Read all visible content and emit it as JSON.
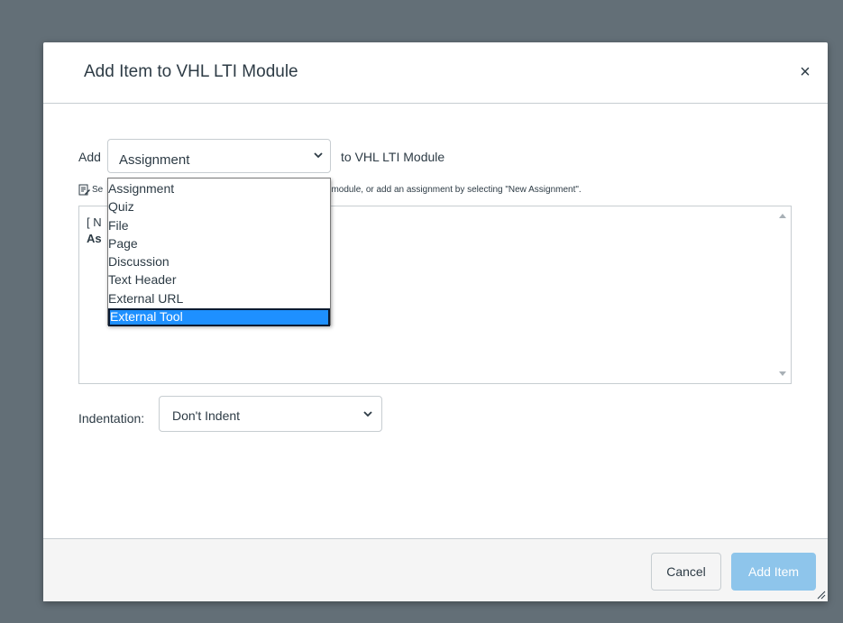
{
  "modal": {
    "title": "Add Item to VHL LTI Module",
    "close_label": "×"
  },
  "add_row": {
    "add_label": "Add",
    "selected_type": "Assignment",
    "to_label": "to VHL LTI Module"
  },
  "help": {
    "prefix": "Se",
    "text": "th this module, or add an assignment by selecting \"New Assignment\"."
  },
  "listbox": {
    "line1": "[ N",
    "line2": "As"
  },
  "indentation": {
    "label": "Indentation:",
    "selected": "Don't Indent"
  },
  "footer": {
    "cancel_label": "Cancel",
    "add_label": "Add Item"
  },
  "dropdown": {
    "options": [
      "Assignment",
      "Quiz",
      "File",
      "Page",
      "Discussion",
      "Text Header",
      "External URL",
      "External Tool"
    ],
    "highlighted": "External Tool"
  },
  "colors": {
    "overlay": "#636f77",
    "primary_disabled": "#8ec5eb",
    "highlight": "#1e90ff"
  }
}
